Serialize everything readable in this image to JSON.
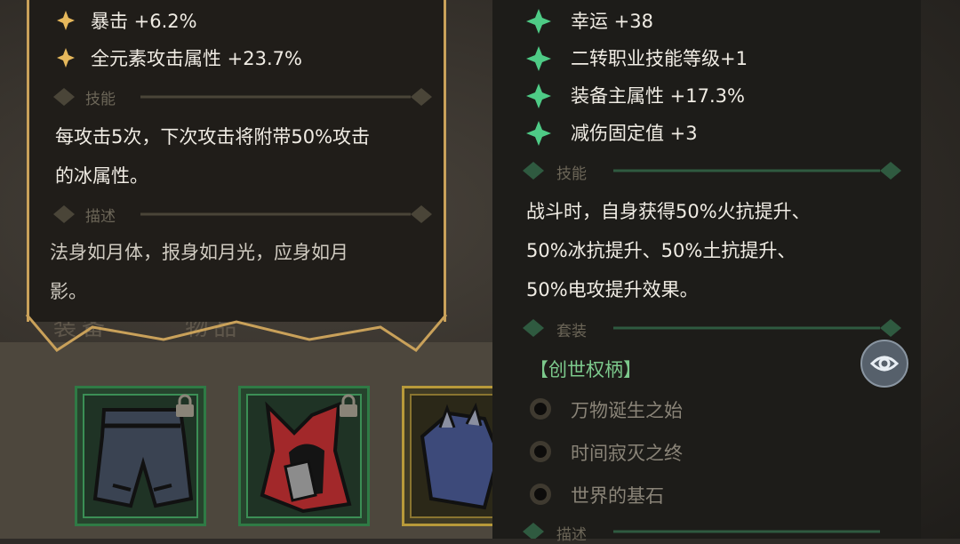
{
  "left_tooltip": {
    "stats": [
      {
        "label": "暴击 +6.2%",
        "icon": "gold-sparkle-icon"
      },
      {
        "label": "全元素攻击属性 +23.7%",
        "icon": "gold-sparkle-icon"
      }
    ],
    "skill_header": "技能",
    "skill_lines": [
      "每攻击5次，下次攻击将附带50%攻击",
      "的冰属性。"
    ],
    "desc_header": "描述",
    "desc_lines": [
      "法身如月体，报身如月光，应身如月",
      "影。"
    ]
  },
  "inventory": {
    "tabs": [
      "装备",
      "物品"
    ],
    "slots": [
      {
        "item": "pants-icon",
        "locked": true,
        "frame": "green"
      },
      {
        "item": "red-hood-icon",
        "locked": true,
        "frame": "green"
      },
      {
        "item": "spiked-gauntlet-icon",
        "locked": false,
        "frame": "gold"
      }
    ]
  },
  "right_tooltip": {
    "stats": [
      {
        "label": "幸运 +38",
        "icon": "green-sparkle-icon"
      },
      {
        "label": "二转职业技能等级+1",
        "icon": "green-sparkle-icon"
      },
      {
        "label": "装备主属性 +17.3%",
        "icon": "green-sparkle-icon"
      },
      {
        "label": "减伤固定值 +3",
        "icon": "green-sparkle-icon"
      }
    ],
    "skill_header": "技能",
    "skill_lines": [
      "战斗时，自身获得50%火抗提升、",
      "50%冰抗提升、50%土抗提升、",
      "50%电攻提升效果。"
    ],
    "set_header": "套装",
    "set_name": "【创世权柄】",
    "set_items": [
      "万物诞生之始",
      "时间寂灭之终",
      "世界的基石"
    ],
    "desc_header": "描述"
  },
  "colors": {
    "gold": "#c9a15a",
    "green": "#4ecb86",
    "text": "#f0ece4",
    "muted": "#6c6658"
  }
}
